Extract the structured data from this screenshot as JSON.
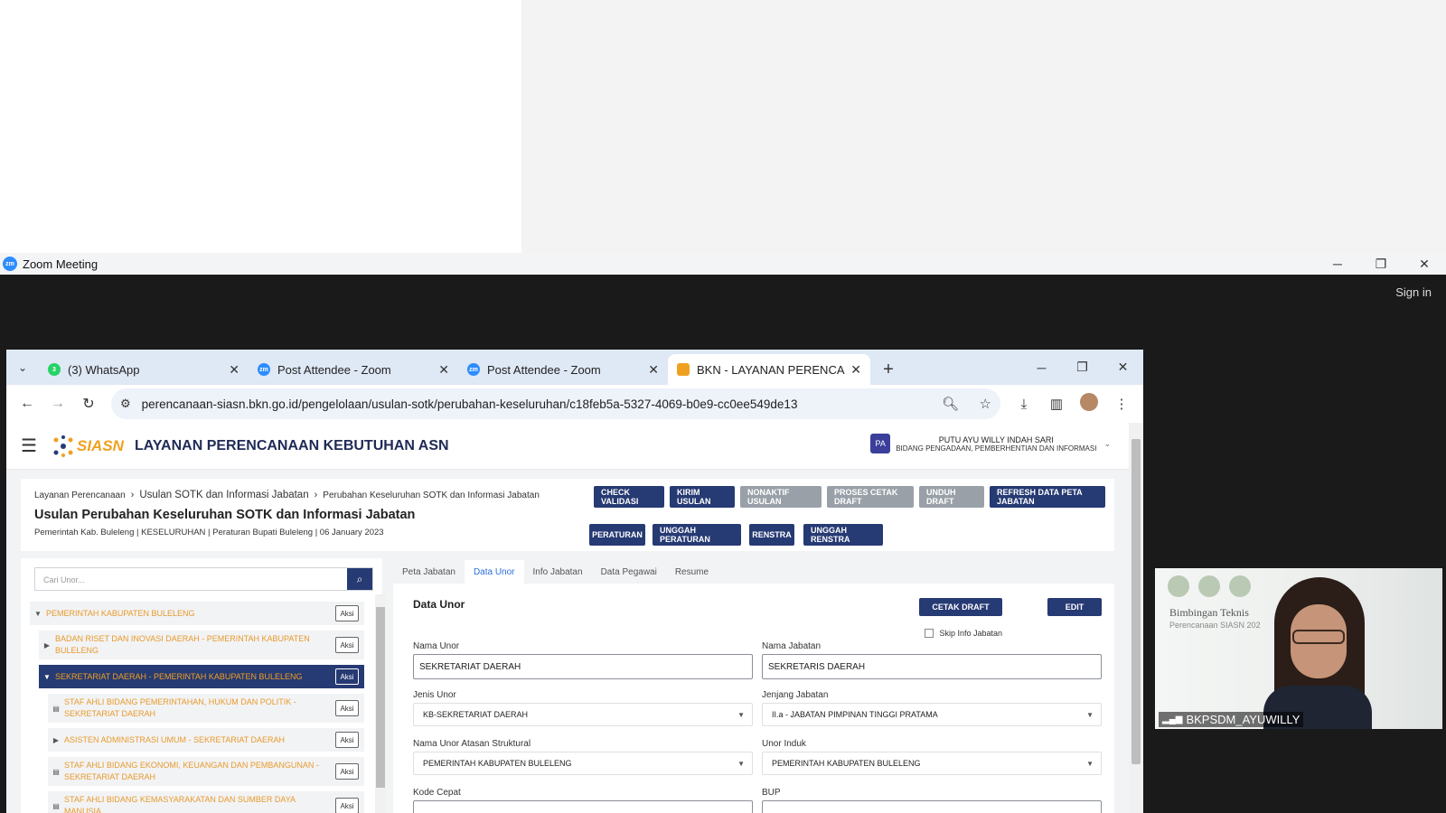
{
  "zoom": {
    "title": "Zoom Meeting",
    "sign_in": "Sign in",
    "logo": "zm"
  },
  "browser": {
    "tabs": [
      {
        "label": "(3) WhatsApp",
        "icon": "whatsapp-icon",
        "color": "#25d366",
        "badge": "3"
      },
      {
        "label": "Post Attendee - Zoom",
        "icon": "zoom-icon",
        "color": "#2d8cff",
        "badge": "zm"
      },
      {
        "label": "Post Attendee - Zoom",
        "icon": "zoom-icon",
        "color": "#2d8cff",
        "badge": "zm"
      },
      {
        "label": "BKN - LAYANAN PERENCANAA",
        "icon": "bkn-icon",
        "color": "#f0a020",
        "badge": ""
      }
    ],
    "url": "perencanaan-siasn.bkn.go.id/pengelolaan/usulan-sotk/perubahan-keseluruhan/c18feb5a-5327-4069-b0e9-cc0ee549de13"
  },
  "app": {
    "logo_text": "SIASN",
    "title": "LAYANAN PERENCANAAN KEBUTUHAN ASN",
    "user": {
      "initials": "PA",
      "name": "PUTU AYU WILLY INDAH SARI",
      "unit": "BIDANG PENGADAAN, PEMBERHENTIAN DAN INFORMASI"
    }
  },
  "breadcrumb": {
    "item1": "Layanan Perencanaan",
    "item2": "Usulan SOTK dan Informasi Jabatan",
    "item3": "Perubahan Keseluruhan SOTK dan Informasi Jabatan"
  },
  "page": {
    "title": "Usulan Perubahan Keseluruhan SOTK dan Informasi Jabatan",
    "subtitle": "Pemerintah Kab. Buleleng | KESELURUHAN | Peraturan Bupati Buleleng | 06 January 2023"
  },
  "actions": {
    "check_validasi": "CHECK VALIDASI",
    "kirim_usulan": "KIRIM USULAN",
    "nonaktif_usulan": "NONAKTIF USULAN",
    "proses_cetak_draft": "PROSES CETAK DRAFT",
    "unduh_draft": "UNDUH DRAFT",
    "refresh": "REFRESH DATA PETA JABATAN",
    "peraturan": "PERATURAN",
    "unggah_peraturan": "UNGGAH PERATURAN",
    "renstra": "RENSTRA",
    "unggah_renstra": "UNGGAH RENSTRA"
  },
  "tree": {
    "search_placeholder": "Cari Unor...",
    "aksi": "Aksi",
    "items": [
      {
        "label": "PEMERINTAH KABUPATEN BULELENG",
        "caret": "▼"
      },
      {
        "label": "BADAN RISET DAN INOVASI DAERAH - PEMERINTAH KABUPATEN BULELENG",
        "caret": "▶"
      },
      {
        "label": "SEKRETARIAT DAERAH - PEMERINTAH KABUPATEN BULELENG",
        "caret": "▼"
      },
      {
        "label": "STAF AHLI BIDANG PEMERINTAHAN, HUKUM DAN POLITIK - SEKRETARIAT DAERAH",
        "caret": "▤"
      },
      {
        "label": "ASISTEN ADMINISTRASI UMUM - SEKRETARIAT DAERAH",
        "caret": "▶"
      },
      {
        "label": "STAF AHLI BIDANG EKONOMI, KEUANGAN DAN PEMBANGUNAN - SEKRETARIAT DAERAH",
        "caret": "▤"
      },
      {
        "label": "STAF AHLI BIDANG KEMASYARAKATAN DAN SUMBER DAYA MANUSIA",
        "caret": "▤"
      }
    ]
  },
  "tabs": [
    "Peta Jabatan",
    "Data Unor",
    "Info Jabatan",
    "Data Pegawai",
    "Resume"
  ],
  "form": {
    "title": "Data Unor",
    "cetak_draft": "CETAK DRAFT",
    "edit": "EDIT",
    "skip_label": "Skip Info Jabatan",
    "nama_unor_label": "Nama Unor",
    "nama_unor": "SEKRETARIAT DAERAH",
    "nama_jabatan_label": "Nama Jabatan",
    "nama_jabatan": "SEKRETARIS DAERAH",
    "jenis_unor_label": "Jenis Unor",
    "jenis_unor": "KB-SEKRETARIAT DAERAH",
    "jenjang_label": "Jenjang Jabatan",
    "jenjang": "II.a - JABATAN PIMPINAN TINGGI PRATAMA",
    "atasan_label": "Nama Unor Atasan Struktural",
    "atasan": "PEMERINTAH KABUPATEN BULELENG",
    "induk_label": "Unor Induk",
    "induk": "PEMERINTAH KABUPATEN BULELENG",
    "kode_label": "Kode Cepat",
    "bup_label": "BUP"
  },
  "video": {
    "title": "Bimbingan Teknis",
    "subtitle": "Perencanaan SIASN 202",
    "participant": "BKPSDM_AYUWILLY"
  }
}
